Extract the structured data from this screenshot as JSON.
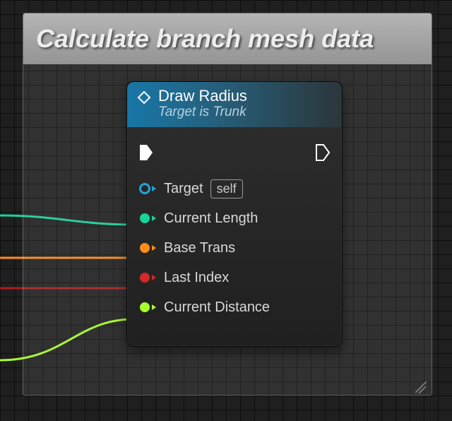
{
  "comment": {
    "title": "Calculate branch mesh data"
  },
  "node": {
    "title": "Draw Radius",
    "subtitle": "Target is Trunk",
    "pins": {
      "target": {
        "label": "Target",
        "default": "self",
        "color": "#1fa6d6"
      },
      "currentLength": {
        "label": "Current Length",
        "color": "#17d39a"
      },
      "baseTrans": {
        "label": "Base Trans",
        "color": "#ff8c1a"
      },
      "lastIndex": {
        "label": "Last Index",
        "color": "#d62828"
      },
      "currentDistance": {
        "label": "Current Distance",
        "color": "#a8ff2e"
      }
    }
  },
  "colors": {
    "headerGradientStart": "#1877a7",
    "headerGradientEnd": "#2b363a"
  }
}
